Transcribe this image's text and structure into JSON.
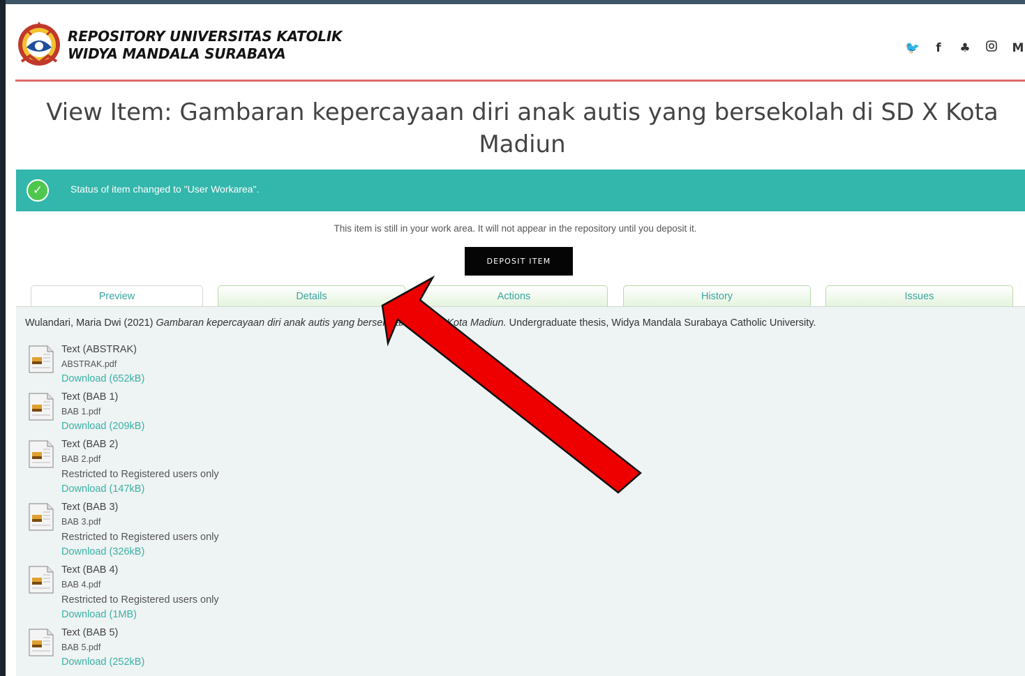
{
  "site": {
    "brand_line1": "REPOSITORY UNIVERSITAS KATOLIK",
    "brand_line2": "WIDYA MANDALA SURABAYA",
    "social_icons": [
      "twitter-icon",
      "facebook-icon",
      "snapchat-icon",
      "instagram-icon",
      "medium-icon"
    ]
  },
  "page": {
    "title": "View Item: Gambaran kepercayaan diri anak autis yang bersekolah di SD X Kota Madiun"
  },
  "status": {
    "message": "Status of item changed to \"User Workarea\"."
  },
  "workarea": {
    "note": "This item is still in your work area. It will not appear in the repository until you deposit it.",
    "deposit_label": "DEPOSIT ITEM"
  },
  "tabs": [
    {
      "label": "Preview",
      "active": true
    },
    {
      "label": "Details",
      "active": false
    },
    {
      "label": "Actions",
      "active": false
    },
    {
      "label": "History",
      "active": false
    },
    {
      "label": "Issues",
      "active": false
    }
  ],
  "citation": {
    "authors": "Wulandari, Maria Dwi (2021) ",
    "title": "Gambaran kepercayaan diri anak autis yang bersekolah di SD X Kota Madiun.",
    "rest": " Undergraduate thesis, Widya Mandala Surabaya Catholic University."
  },
  "documents": [
    {
      "type": "Text (ABSTRAK)",
      "file": "ABSTRAK.pdf",
      "restricted": "",
      "download": "Download (652kB)"
    },
    {
      "type": "Text (BAB 1)",
      "file": "BAB 1.pdf",
      "restricted": "",
      "download": "Download (209kB)"
    },
    {
      "type": "Text (BAB 2)",
      "file": "BAB 2.pdf",
      "restricted": "Restricted to Registered users only",
      "download": "Download (147kB)"
    },
    {
      "type": "Text (BAB 3)",
      "file": "BAB 3.pdf",
      "restricted": "Restricted to Registered users only",
      "download": "Download (326kB)"
    },
    {
      "type": "Text (BAB 4)",
      "file": "BAB 4.pdf",
      "restricted": "Restricted to Registered users only",
      "download": "Download (1MB)"
    },
    {
      "type": "Text (BAB 5)",
      "file": "BAB 5.pdf",
      "restricted": "",
      "download": "Download (252kB)"
    }
  ],
  "colors": {
    "accent_teal": "#33b6ab",
    "header_rule": "#e06b6b",
    "link": "#3ab2a6",
    "annotation_arrow": "#ee0000"
  }
}
